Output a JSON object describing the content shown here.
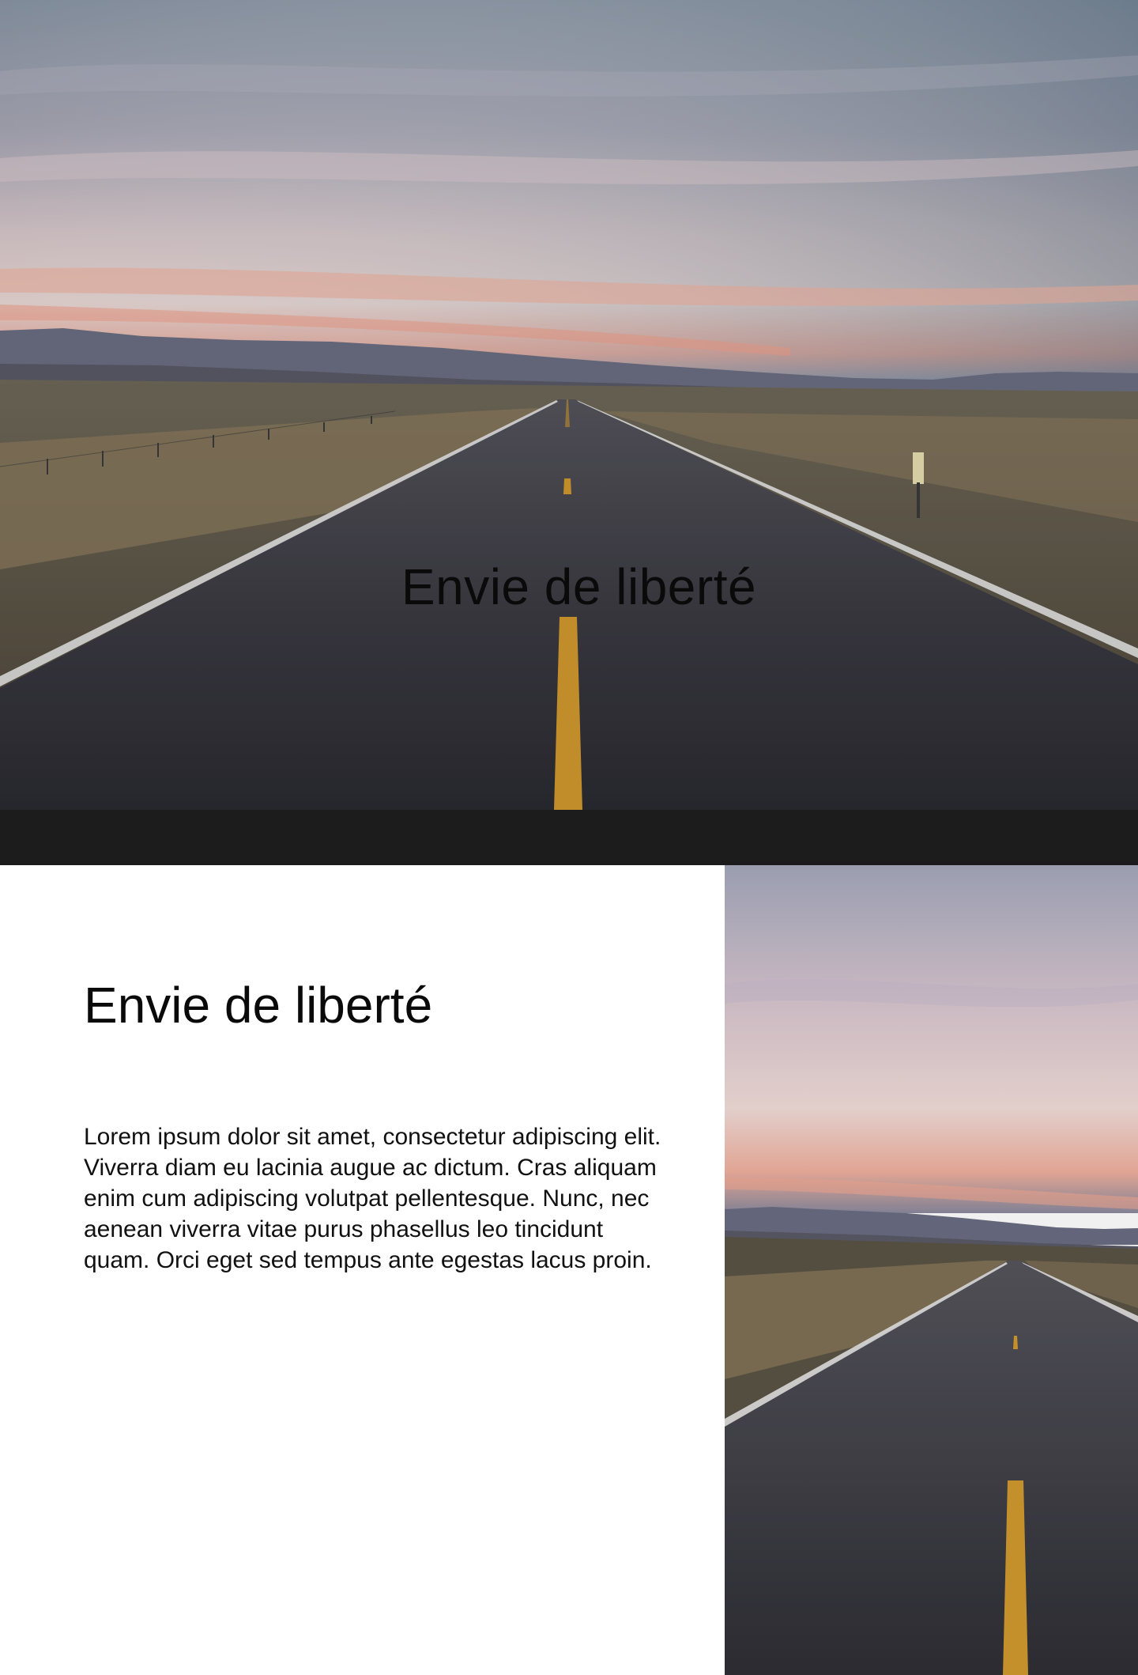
{
  "hero": {
    "title": "Envie de liberté",
    "image_icon": "road-landscape-photo"
  },
  "section": {
    "title": "Envie de liberté",
    "body": "Lorem ipsum dolor sit amet, consectetur adipiscing elit. Viverra diam eu lacinia augue ac dictum. Cras aliquam enim cum adipiscing volutpat pellentesque. Nunc, nec aenean viverra vitae purus phasellus leo tincidunt quam. Orci eget sed tempus ante egestas lacus proin.",
    "image_icon": "road-landscape-photo"
  },
  "colors": {
    "band": "#1c1c1c",
    "text": "#0a0a0a",
    "road_line": "#d19a2e"
  }
}
